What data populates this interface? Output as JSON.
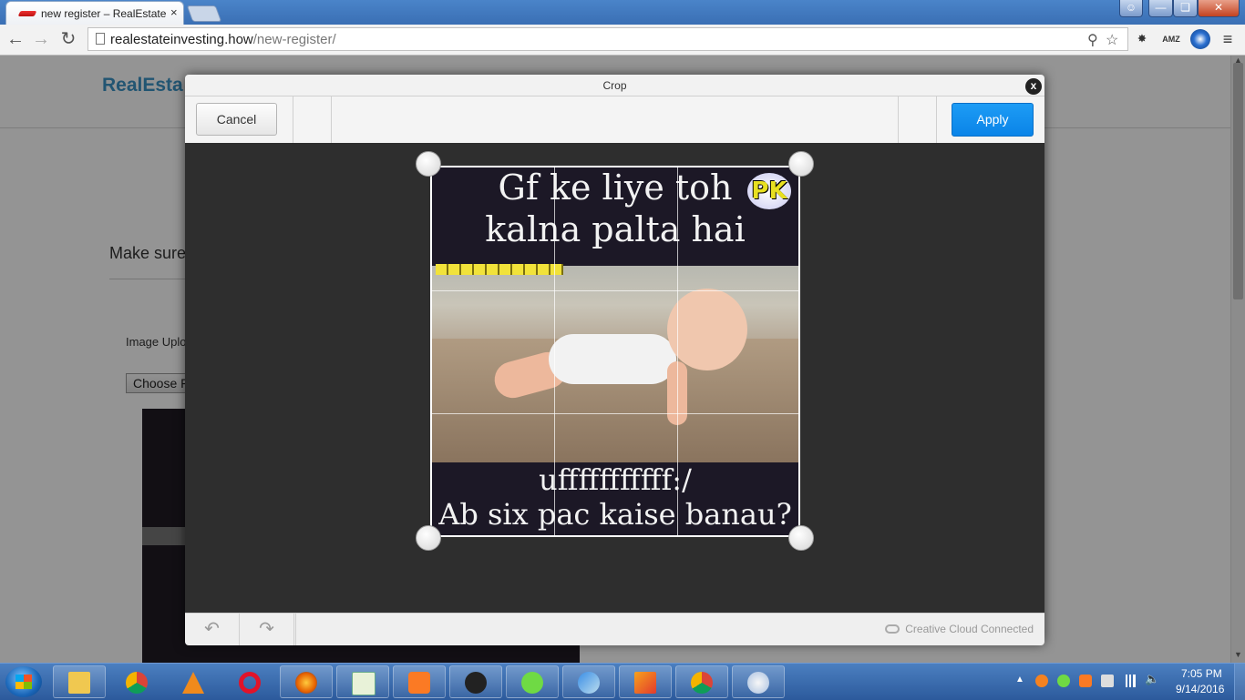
{
  "browser": {
    "tab_title": "new register – RealEstateIn",
    "tab_close": "×",
    "url_host": "realestateinvesting.how",
    "url_path": "/new-register/",
    "window_controls": [
      "user-icon",
      "minimize-icon",
      "maximize-icon",
      "close-icon"
    ],
    "extensions": [
      "puzzle-icon",
      "AMZ",
      "chrome-logo-icon"
    ]
  },
  "page": {
    "logo_part1": "RealEsta",
    "instruction": "Make sure",
    "upload_label": "Image Uplo",
    "choose_file_label": "Choose F"
  },
  "crop_modal": {
    "title": "Crop",
    "close": "x",
    "cancel_label": "Cancel",
    "apply_label": "Apply",
    "status": "Creative Cloud Connected",
    "image": {
      "top_line_1": "Gf ke liye toh",
      "top_line_2": "kalna palta hai",
      "bottom_line_1": "ufffffffffff:/",
      "bottom_line_2": "Ab six pac kaise banau?",
      "badge": "PK"
    }
  },
  "taskbar": {
    "apps": [
      "file-explorer-icon",
      "chrome-icon",
      "vlc-icon",
      "opera-icon",
      "firefox-icon",
      "notepad-icon",
      "xampp-icon",
      "spy-icon",
      "upwork-icon",
      "feather-icon",
      "illustrator-icon",
      "chrome-icon",
      "paint-icon"
    ],
    "time": "7:05 PM",
    "date": "9/14/2016"
  },
  "colors": {
    "apply": "#0a84e8",
    "taskbar": "#2c5a9c",
    "logo": "#3b93c5"
  }
}
